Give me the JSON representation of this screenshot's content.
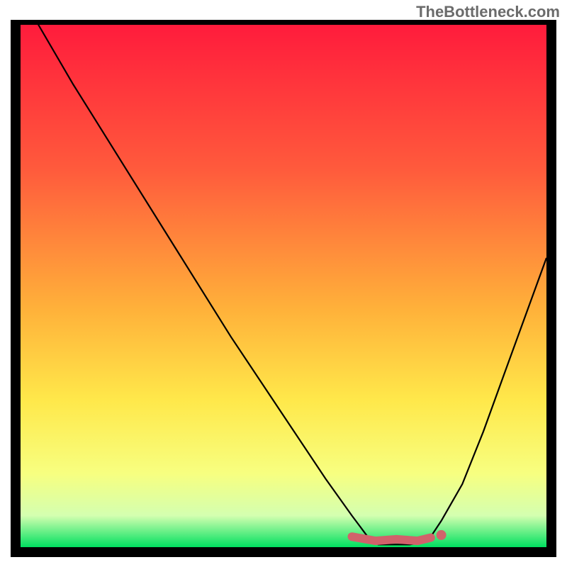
{
  "watermark": "TheBottleneck.com",
  "chart_data": {
    "type": "line",
    "title": "",
    "xlabel": "",
    "ylabel": "",
    "x_range": [
      0,
      100
    ],
    "y_range": [
      0,
      100
    ],
    "gradient_stops": [
      {
        "offset": 0,
        "color": "#ff1a3c"
      },
      {
        "offset": 28,
        "color": "#ff5a3c"
      },
      {
        "offset": 55,
        "color": "#ffb23a"
      },
      {
        "offset": 72,
        "color": "#ffe84a"
      },
      {
        "offset": 86,
        "color": "#f7ff80"
      },
      {
        "offset": 94,
        "color": "#d4ffb0"
      },
      {
        "offset": 100,
        "color": "#00e060"
      }
    ],
    "curve": {
      "comment": "V-shaped bottleneck curve; y=100 top, y=0 bottom. Valley around x≈68-78.",
      "x": [
        3,
        10,
        20,
        30,
        40,
        50,
        58,
        63,
        66,
        68,
        70,
        72,
        74,
        76,
        78,
        80,
        84,
        88,
        92,
        96,
        100
      ],
      "y": [
        100,
        88,
        72,
        56,
        40,
        25,
        13,
        6,
        2,
        0.5,
        0.5,
        0.5,
        0.5,
        0.8,
        2,
        5,
        12,
        22,
        33,
        44,
        55
      ]
    },
    "valley_marker": {
      "x_start": 63,
      "x_end": 80,
      "y": 1.2,
      "color": "#d1626b",
      "dot_x": 80,
      "dot_y": 2.3
    },
    "frame_border_color": "#000000",
    "curve_color": "#000000"
  }
}
